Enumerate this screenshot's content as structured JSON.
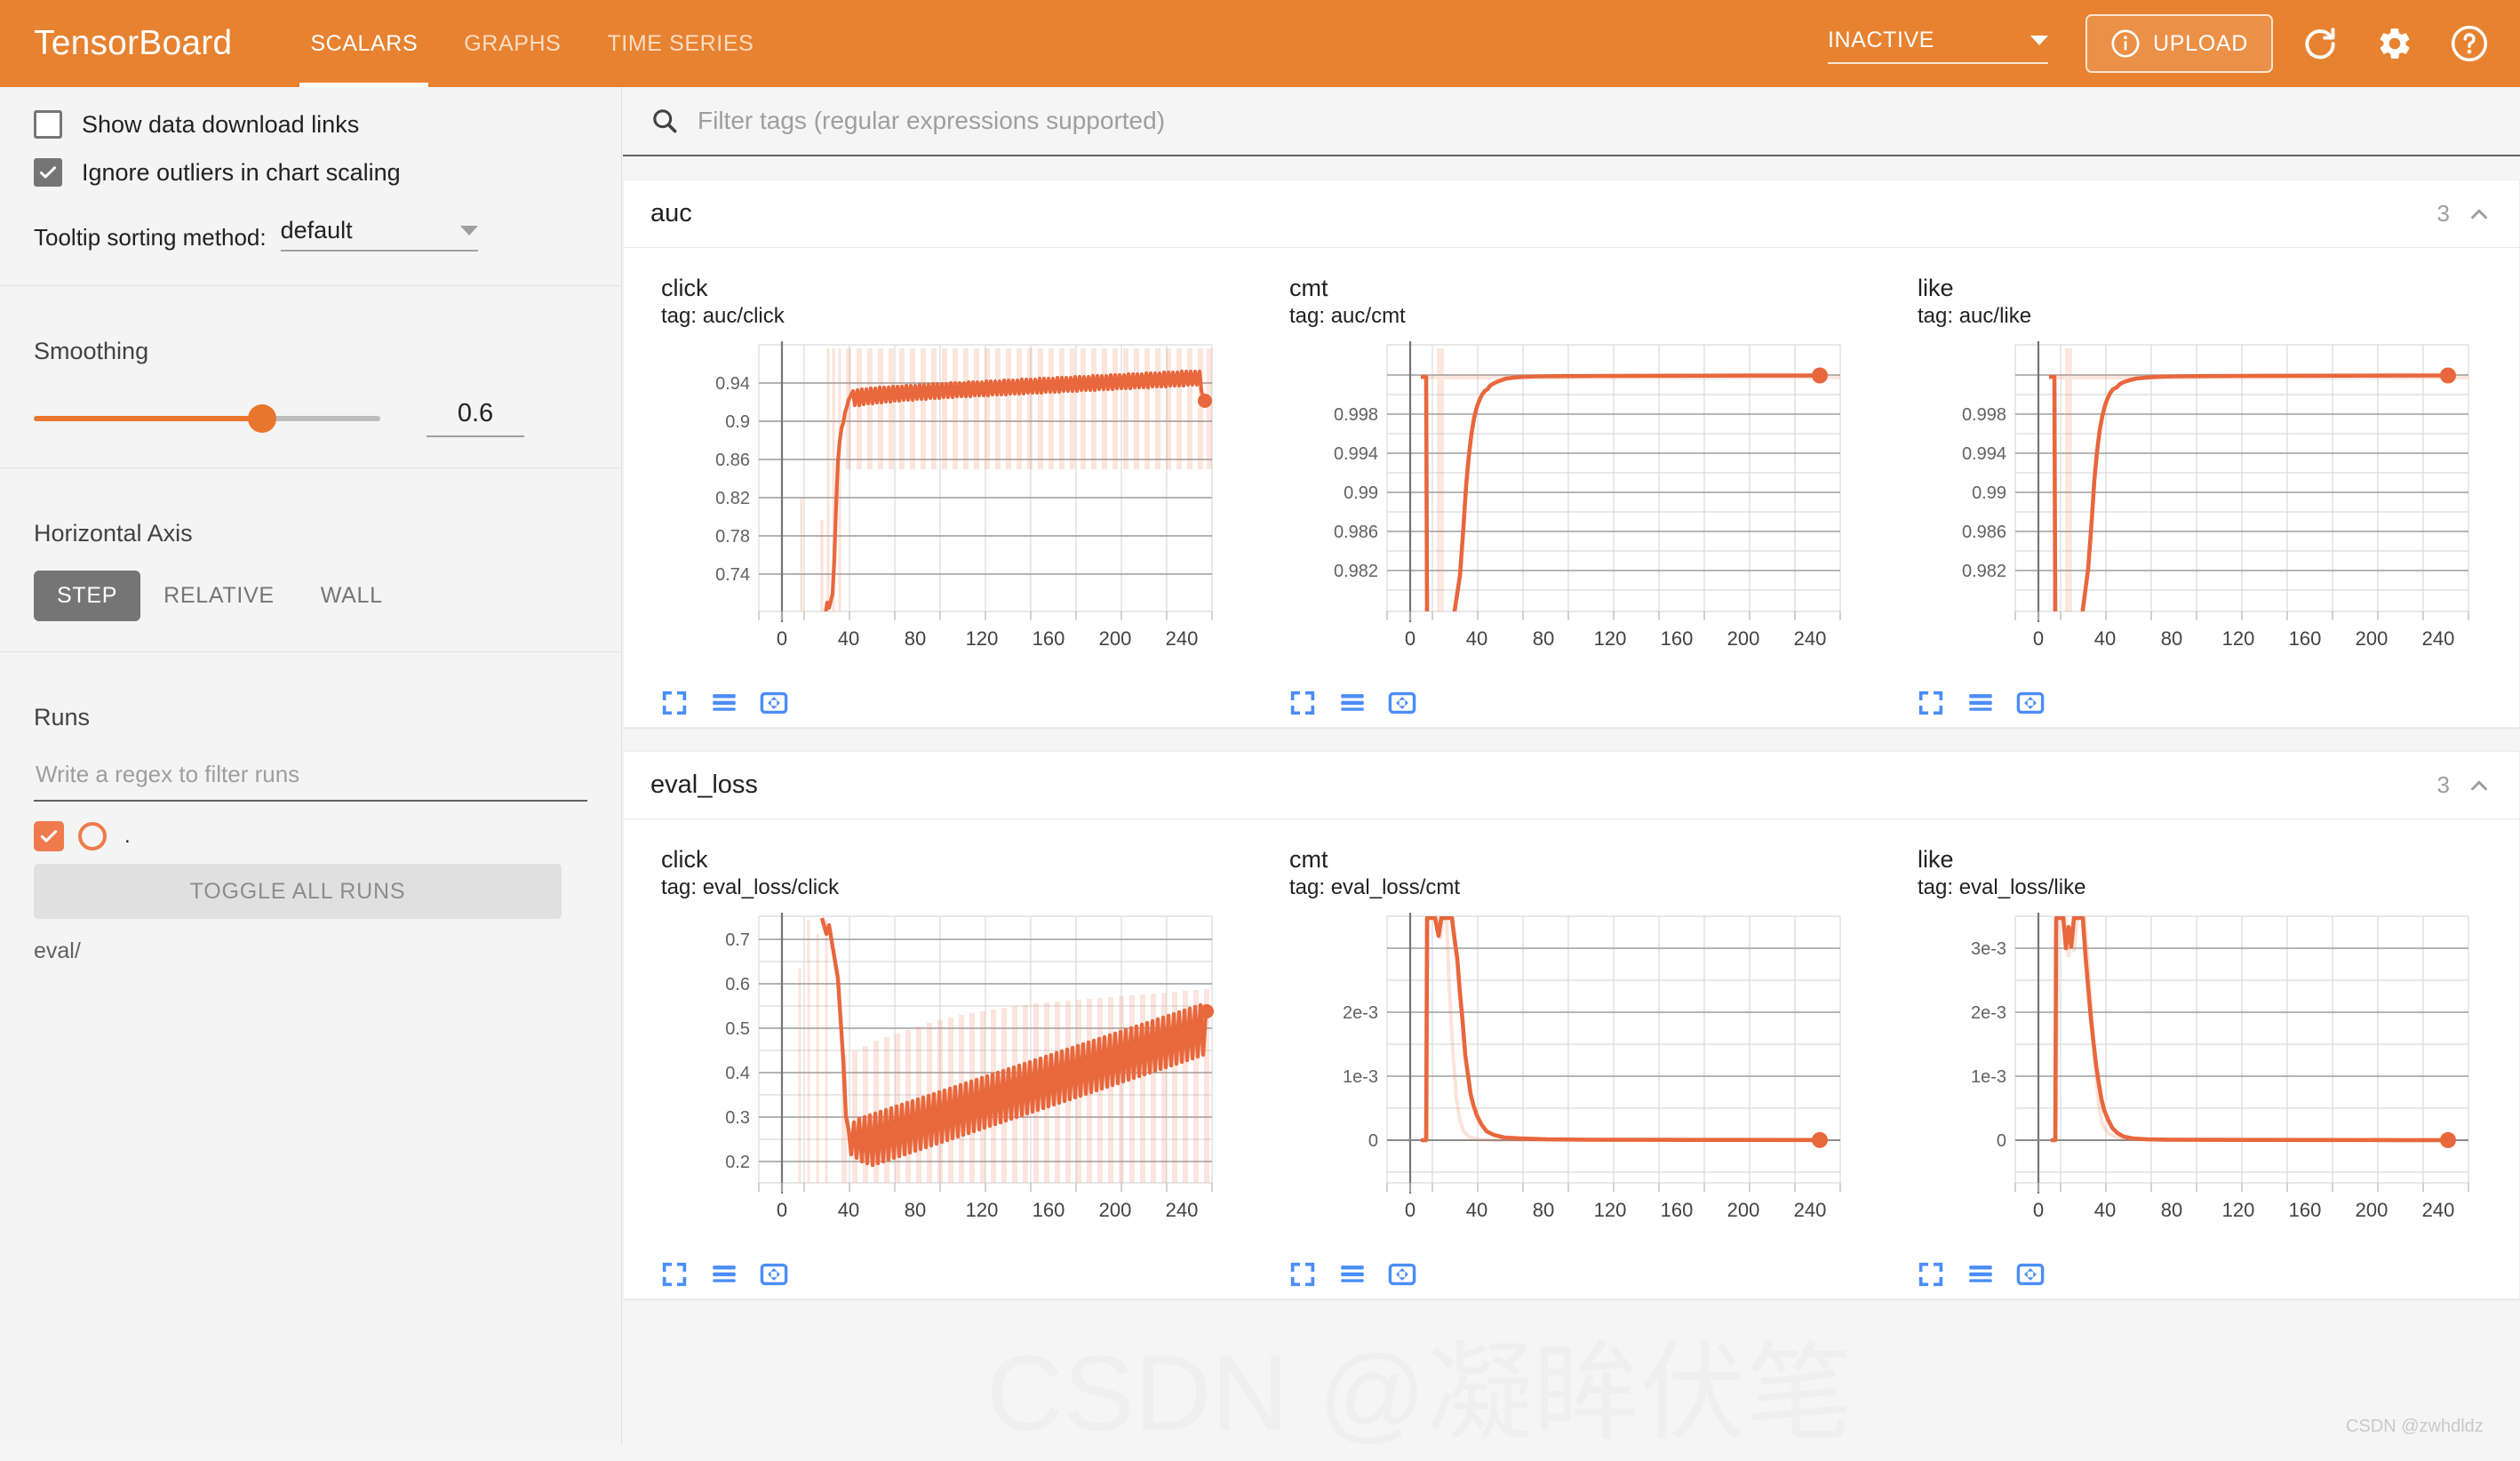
{
  "header": {
    "brand": "TensorBoard",
    "tabs": [
      {
        "label": "SCALARS",
        "active": true
      },
      {
        "label": "GRAPHS",
        "active": false
      },
      {
        "label": "TIME SERIES",
        "active": false
      }
    ],
    "run_status": "INACTIVE",
    "upload_label": "UPLOAD",
    "icons": [
      "info-icon",
      "refresh-icon",
      "gear-icon",
      "help-icon"
    ],
    "accent_color": "#e78230"
  },
  "sidebar": {
    "show_download_links": {
      "label": "Show data download links",
      "checked": false
    },
    "ignore_outliers": {
      "label": "Ignore outliers in chart scaling",
      "checked": true
    },
    "tooltip_sorting": {
      "label": "Tooltip sorting method:",
      "value": "default"
    },
    "smoothing": {
      "label": "Smoothing",
      "value": "0.6",
      "fraction": 0.6
    },
    "horizontal_axis": {
      "label": "Horizontal Axis",
      "options": [
        "STEP",
        "RELATIVE",
        "WALL"
      ],
      "selected": "STEP"
    },
    "runs": {
      "label": "Runs",
      "filter_placeholder": "Write a regex to filter runs",
      "filter_value": "",
      "items": [
        {
          "name": ".",
          "checked": true,
          "color": "#ef7a4b"
        }
      ],
      "toggle_all_label": "TOGGLE ALL RUNS",
      "run_path": "eval/"
    }
  },
  "search": {
    "placeholder": "Filter tags (regular expressions supported)",
    "value": ""
  },
  "sections": [
    {
      "title": "auc",
      "count": "3",
      "charts": [
        {
          "name": "click",
          "tag": "tag: auc/click"
        },
        {
          "name": "cmt",
          "tag": "tag: auc/cmt"
        },
        {
          "name": "like",
          "tag": "tag: auc/like"
        }
      ]
    },
    {
      "title": "eval_loss",
      "count": "3",
      "charts": [
        {
          "name": "click",
          "tag": "tag: eval_loss/click"
        },
        {
          "name": "cmt",
          "tag": "tag: eval_loss/cmt"
        },
        {
          "name": "like",
          "tag": "tag: eval_loss/like"
        }
      ]
    }
  ],
  "chart_tools": [
    "fullscreen-icon",
    "data-table-icon",
    "pan-fit-icon"
  ],
  "watermark": {
    "big": "CSDN @凝眸伏笔",
    "small": "CSDN @zwhdldz"
  },
  "chart_data": [
    {
      "type": "line",
      "title": "click",
      "subtitle": "tag: auc/click",
      "xlabel": "",
      "ylabel": "",
      "xticks": [
        0,
        40,
        80,
        120,
        160,
        200,
        240
      ],
      "yticks": [
        0.74,
        0.78,
        0.82,
        0.86,
        0.9,
        0.94
      ],
      "xlim": [
        -12,
        272
      ],
      "ylim": [
        0.715,
        0.962
      ],
      "grid": true,
      "legend": false,
      "series": [
        {
          "name": "eval/ (smoothed)",
          "color": "#e8673c",
          "x": [
            0,
            8,
            16,
            24,
            28,
            30,
            32,
            34,
            36,
            38,
            40,
            42,
            44,
            46,
            48,
            50,
            54,
            58,
            62,
            70,
            80,
            100,
            120,
            140,
            160,
            180,
            200,
            220,
            240,
            258
          ],
          "values": [
            0.7,
            0.7,
            0.71,
            0.722,
            0.735,
            0.712,
            0.722,
            0.745,
            0.8,
            0.865,
            0.905,
            0.918,
            0.922,
            0.93,
            0.938,
            0.939,
            0.942,
            0.944,
            0.945,
            0.946,
            0.947,
            0.948,
            0.948,
            0.949,
            0.949,
            0.95,
            0.95,
            0.95,
            0.951,
            0.922
          ]
        }
      ],
      "oscillation": {
        "present": true,
        "amplitude": 0.017,
        "period_steps": 4,
        "start_step": 50
      },
      "shadow_band": {
        "present": true,
        "upper": 0.962,
        "lower": 0.876,
        "start_step": 46
      },
      "endpoint_marker": {
        "x": 258,
        "y": 0.922
      }
    },
    {
      "type": "line",
      "title": "cmt",
      "subtitle": "tag: auc/cmt",
      "xticks": [
        0,
        40,
        80,
        120,
        160,
        200,
        240
      ],
      "yticks": [
        0.982,
        0.986,
        0.99,
        0.994,
        0.998
      ],
      "xlim": [
        -12,
        272
      ],
      "ylim": [
        0.9796,
        1.0003
      ],
      "grid": true,
      "legend": false,
      "series": [
        {
          "name": "eval/ (smoothed)",
          "color": "#e8673c",
          "x": [
            0,
            6,
            7,
            8,
            32,
            34,
            36,
            38,
            40,
            42,
            44,
            46,
            48,
            50,
            54,
            58,
            62,
            70,
            90,
            130,
            170,
            210,
            250,
            262
          ],
          "values": [
            0.9999,
            0.9999,
            0.9999,
            0.979,
            0.979,
            0.9865,
            0.9925,
            0.9945,
            0.9967,
            0.9978,
            0.9985,
            0.9988,
            0.999,
            0.9991,
            0.9993,
            0.99955,
            0.99965,
            0.99975,
            0.99985,
            0.9999,
            0.99992,
            0.99993,
            0.99994,
            0.99994
          ]
        }
      ],
      "endpoint_marker": {
        "x": 262,
        "y": 0.99994
      }
    },
    {
      "type": "line",
      "title": "like",
      "subtitle": "tag: auc/like",
      "xticks": [
        0,
        40,
        80,
        120,
        160,
        200,
        240
      ],
      "yticks": [
        0.982,
        0.986,
        0.99,
        0.994,
        0.998
      ],
      "xlim": [
        -12,
        272
      ],
      "ylim": [
        0.9796,
        1.0003
      ],
      "grid": true,
      "legend": false,
      "series": [
        {
          "name": "eval/ (smoothed)",
          "color": "#e8673c",
          "x": [
            0,
            6,
            7,
            8,
            32,
            34,
            36,
            38,
            40,
            42,
            44,
            46,
            48,
            52,
            56,
            60,
            68,
            90,
            130,
            170,
            210,
            250,
            262
          ],
          "values": [
            0.9999,
            0.9999,
            0.9999,
            0.979,
            0.979,
            0.9858,
            0.9918,
            0.994,
            0.9962,
            0.9975,
            0.9983,
            0.9987,
            0.9989,
            0.9991,
            0.99935,
            0.99955,
            0.99975,
            0.99985,
            0.9999,
            0.99992,
            0.99993,
            0.99994,
            0.99994
          ]
        }
      ],
      "endpoint_marker": {
        "x": 262,
        "y": 0.99994
      }
    },
    {
      "type": "line",
      "title": "click",
      "subtitle": "tag: eval_loss/click",
      "xticks": [
        0,
        40,
        80,
        120,
        160,
        200,
        240
      ],
      "yticks": [
        0.2,
        0.3,
        0.4,
        0.5,
        0.6,
        0.7
      ],
      "xlim": [
        -12,
        272
      ],
      "ylim": [
        0.155,
        0.757
      ],
      "grid": true,
      "legend": false,
      "series": [
        {
          "name": "eval/ (smoothed)",
          "color": "#e8673c",
          "x": [
            0,
            10,
            18,
            24,
            28,
            30,
            32,
            34,
            38,
            42,
            46,
            50,
            60,
            80,
            100,
            120,
            140,
            160,
            180,
            200,
            220,
            240,
            258
          ],
          "values": [
            0.757,
            0.757,
            0.757,
            0.735,
            0.725,
            0.745,
            0.7,
            0.64,
            0.46,
            0.295,
            0.278,
            0.27,
            0.272,
            0.282,
            0.292,
            0.3,
            0.305,
            0.31,
            0.315,
            0.32,
            0.325,
            0.33,
            0.338
          ]
        }
      ],
      "oscillation": {
        "present": true,
        "amplitude": 0.055,
        "period_steps": 4,
        "start_step": 42
      },
      "shadow_band": {
        "present": true,
        "upper_start": 0.44,
        "upper_end": 0.535,
        "lower": 0.17,
        "start_step": 40
      },
      "endpoint_marker": {
        "x": 258,
        "y": 0.338
      }
    },
    {
      "type": "line",
      "title": "cmt",
      "subtitle": "tag: eval_loss/cmt",
      "xticks": [
        0,
        40,
        80,
        120,
        160,
        200,
        240
      ],
      "yticks": [
        0,
        0.001,
        0.002
      ],
      "ytick_labels": [
        "0",
        "1e-3",
        "2e-3"
      ],
      "xlim": [
        -12,
        272
      ],
      "ylim": [
        -0.0004,
        0.00285
      ],
      "grid": true,
      "legend": false,
      "series": [
        {
          "name": "eval/ (smoothed)",
          "color": "#e8673c",
          "x": [
            0,
            5,
            6,
            12,
            14,
            16,
            30,
            34,
            36,
            38,
            40,
            42,
            44,
            46,
            48,
            52,
            56,
            60,
            70,
            90,
            130,
            170,
            210,
            250,
            262
          ],
          "values": [
            0.0,
            0.0,
            0.00285,
            0.00285,
            0.0026,
            0.00285,
            0.00285,
            0.00285,
            0.0024,
            0.0021,
            0.0013,
            0.00075,
            0.0006,
            0.00038,
            0.0003,
            0.00016,
            8e-05,
            5e-05,
            3e-05,
            2e-05,
            1e-05,
            1e-05,
            1e-05,
            1e-05,
            1e-05
          ]
        }
      ],
      "endpoint_marker": {
        "x": 262,
        "y": 1e-05
      }
    },
    {
      "type": "line",
      "title": "like",
      "subtitle": "tag: eval_loss/like",
      "xticks": [
        0,
        40,
        80,
        120,
        160,
        200,
        240
      ],
      "yticks": [
        0,
        0.001,
        0.002,
        0.003
      ],
      "ytick_labels": [
        "0",
        "1e-3",
        "2e-3",
        "3e-3"
      ],
      "xlim": [
        -12,
        272
      ],
      "ylim": [
        -0.00045,
        0.00415
      ],
      "grid": true,
      "legend": false,
      "series": [
        {
          "name": "eval/ (smoothed)",
          "color": "#e8673c",
          "x": [
            0,
            5,
            6,
            12,
            14,
            16,
            18,
            22,
            30,
            34,
            36,
            38,
            40,
            42,
            44,
            46,
            48,
            52,
            56,
            60,
            70,
            90,
            130,
            170,
            210,
            250,
            262
          ],
          "values": [
            0.0,
            0.0,
            0.00415,
            0.00415,
            0.0034,
            0.0038,
            0.00345,
            0.00415,
            0.00415,
            0.00415,
            0.003,
            0.00215,
            0.0014,
            0.0009,
            0.0006,
            0.00042,
            0.0003,
            0.00018,
            0.0001,
            6e-05,
            3e-05,
            2e-05,
            1e-05,
            1e-05,
            1e-05,
            1e-05,
            1e-05
          ]
        }
      ],
      "endpoint_marker": {
        "x": 262,
        "y": 1e-05
      }
    }
  ]
}
